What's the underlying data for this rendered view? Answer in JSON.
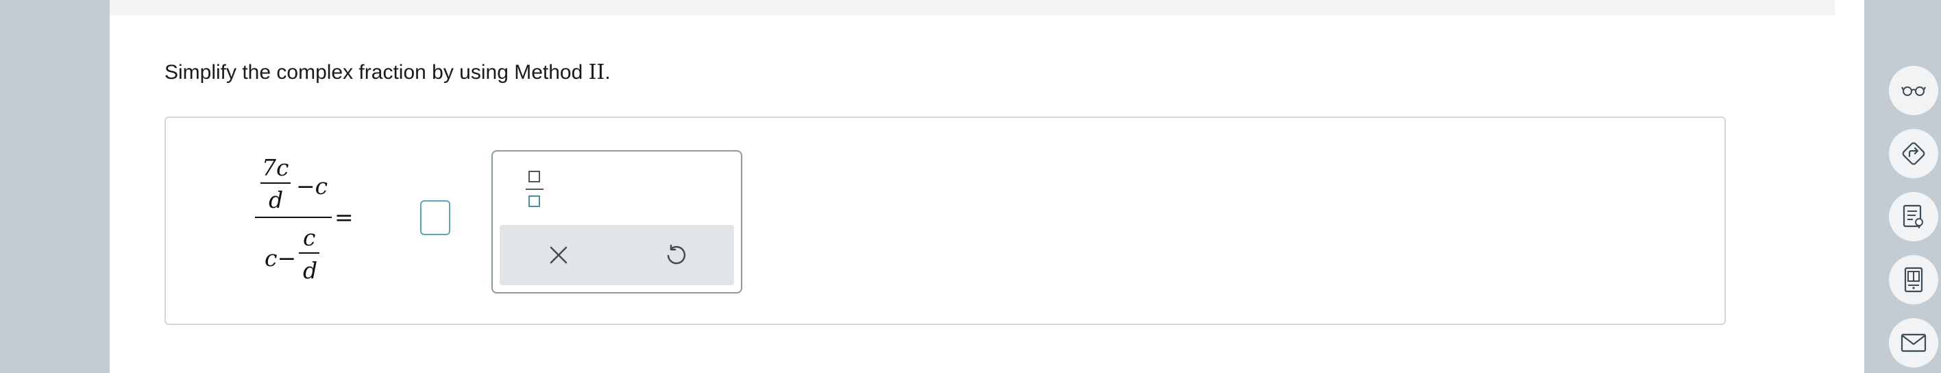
{
  "instruction": {
    "text": "Simplify the complex fraction by using Method ",
    "method": "II",
    "period": "."
  },
  "problem": {
    "top_num_numerator": "7c",
    "top_num_denominator": "d",
    "top_minus_term": "−c",
    "bottom_lead": "c−",
    "bottom_numerator": "c",
    "bottom_denominator": "d",
    "equals": "="
  },
  "answer": {
    "value": ""
  },
  "palette": {
    "items": [
      "fraction-template-icon",
      "clear-icon",
      "undo-icon"
    ],
    "accent_color": "#4a8fa5"
  },
  "sidebar": {
    "tools": [
      "glasses-icon",
      "hint-icon",
      "notes-icon",
      "textbook-icon",
      "mail-icon"
    ]
  },
  "colors": {
    "background": "#c3ccd3",
    "panel": "#ffffff",
    "button": "#f1f3f4",
    "input_border": "#5fa3b8"
  }
}
